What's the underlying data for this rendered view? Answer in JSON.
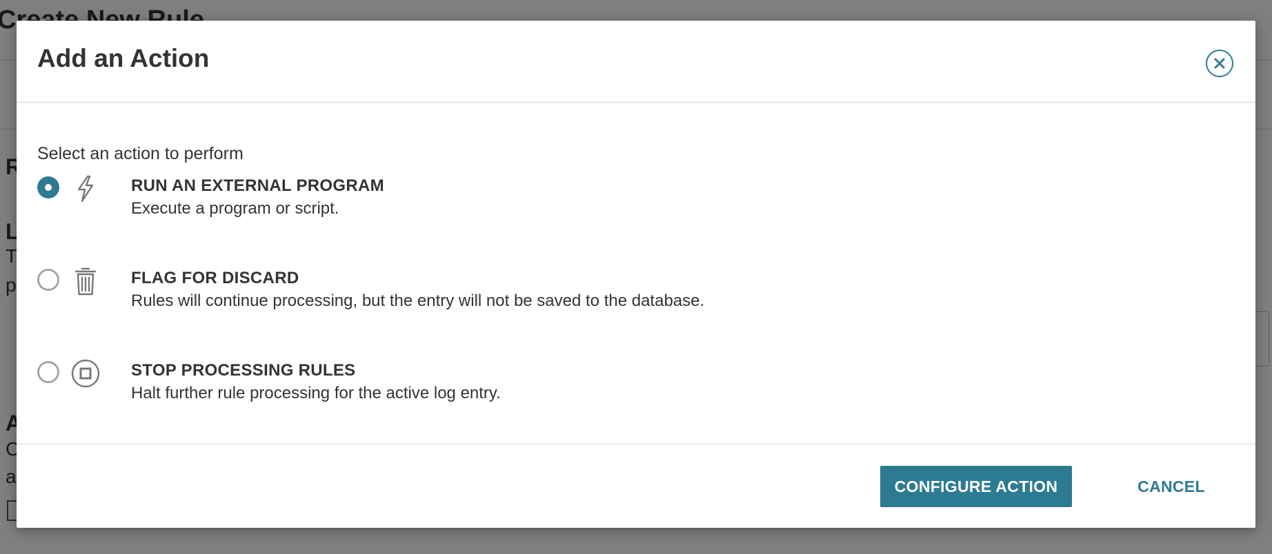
{
  "background": {
    "page_title": "Create New Rule",
    "fragments": [
      "Ru",
      "L",
      "T",
      "p",
      "A",
      "C",
      "a"
    ]
  },
  "modal": {
    "title": "Add an Action",
    "close_icon": "close-circle-icon",
    "prompt": "Select an action to perform",
    "options": [
      {
        "title": "RUN AN EXTERNAL PROGRAM",
        "description": "Execute a program or script.",
        "icon": "lightning-bolt-icon",
        "selected": true
      },
      {
        "title": "FLAG FOR DISCARD",
        "description": "Rules will continue processing, but the entry will not be saved to the database.",
        "icon": "trash-icon",
        "selected": false
      },
      {
        "title": "STOP PROCESSING RULES",
        "description": "Halt further rule processing for the active log entry.",
        "icon": "stop-circle-icon",
        "selected": false
      }
    ],
    "buttons": {
      "configure": "CONFIGURE ACTION",
      "cancel": "CANCEL"
    }
  },
  "colors": {
    "accent": "#2d7b93",
    "text": "#333333",
    "overlay": "rgba(0,0,0,0.5)"
  }
}
